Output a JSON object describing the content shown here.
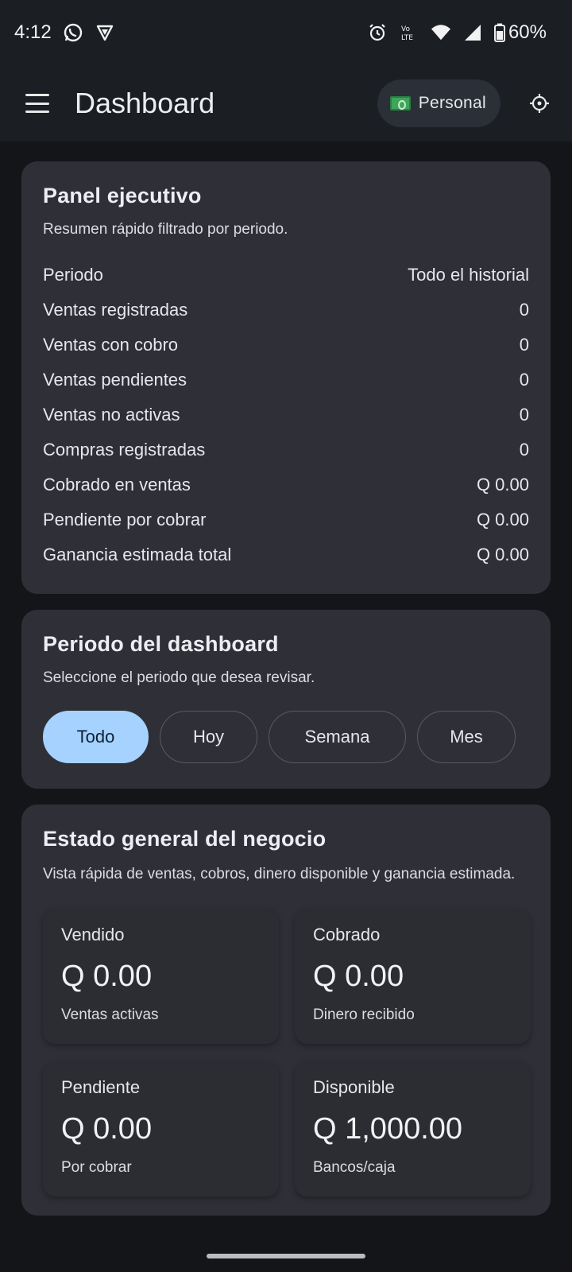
{
  "status_bar": {
    "time": "4:12",
    "battery": "60%",
    "icons": [
      "whatsapp-icon",
      "shield-icon",
      "alarm-icon",
      "volte-icon",
      "wifi-icon",
      "signal-icon",
      "battery-icon"
    ]
  },
  "app_bar": {
    "title": "Dashboard",
    "profile_label": "Personal",
    "profile_icon": "money-icon",
    "settings_icon": "settings-icon"
  },
  "executive_panel": {
    "title": "Panel ejecutivo",
    "subtitle": "Resumen rápido filtrado por periodo.",
    "rows": [
      {
        "label": "Periodo",
        "value": "Todo el historial"
      },
      {
        "label": "Ventas registradas",
        "value": "0"
      },
      {
        "label": "Ventas con cobro",
        "value": "0"
      },
      {
        "label": "Ventas pendientes",
        "value": "0"
      },
      {
        "label": "Ventas no activas",
        "value": "0"
      },
      {
        "label": "Compras registradas",
        "value": "0"
      },
      {
        "label": "Cobrado en ventas",
        "value": "Q 0.00"
      },
      {
        "label": "Pendiente por cobrar",
        "value": "Q 0.00"
      },
      {
        "label": "Ganancia estimada total",
        "value": "Q 0.00"
      }
    ]
  },
  "period_panel": {
    "title": "Periodo del dashboard",
    "subtitle": "Seleccione el periodo que desea revisar.",
    "options": [
      {
        "label": "Todo",
        "selected": true
      },
      {
        "label": "Hoy",
        "selected": false
      },
      {
        "label": "Semana",
        "selected": false
      },
      {
        "label": "Mes",
        "selected": false
      }
    ]
  },
  "business_panel": {
    "title": "Estado general del negocio",
    "subtitle": "Vista rápida de ventas, cobros, dinero disponible y ganancia estimada.",
    "stats": [
      {
        "label": "Vendido",
        "value": "Q 0.00",
        "caption": "Ventas activas"
      },
      {
        "label": "Cobrado",
        "value": "Q 0.00",
        "caption": "Dinero recibido"
      },
      {
        "label": "Pendiente",
        "value": "Q 0.00",
        "caption": "Por cobrar"
      },
      {
        "label": "Disponible",
        "value": "Q 1,000.00",
        "caption": "Bancos/caja"
      }
    ]
  },
  "colors": {
    "background": "#131519",
    "surface": "#2f3037",
    "accent": "#a6d2ff"
  }
}
